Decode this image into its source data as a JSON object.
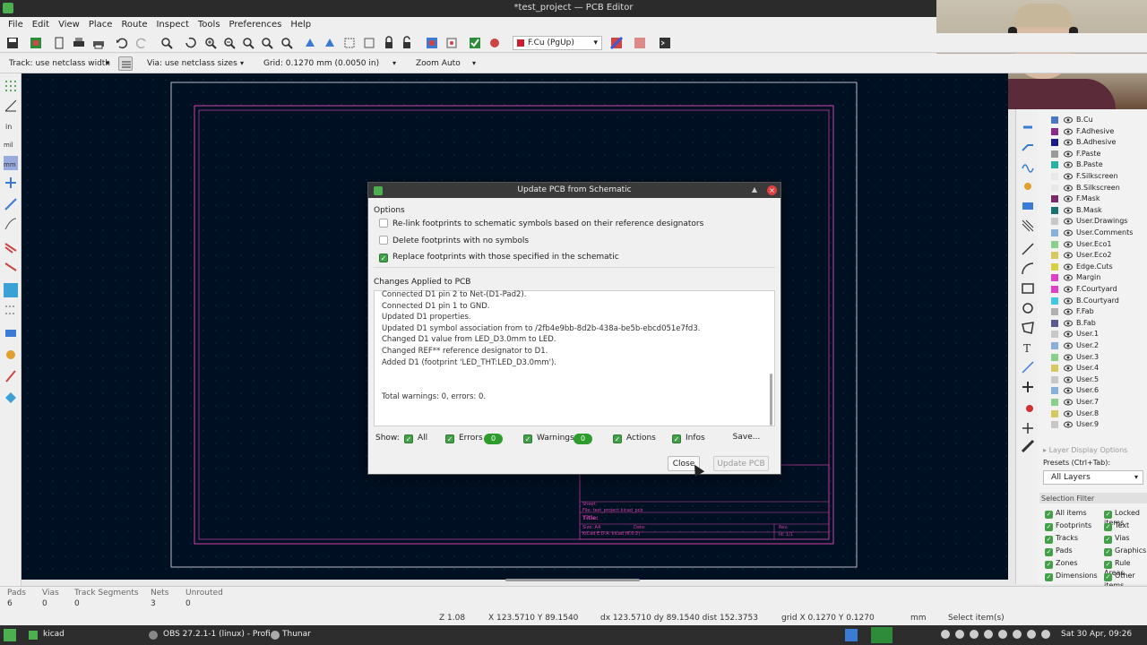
{
  "window": {
    "title": "*test_project — PCB Editor"
  },
  "menu": [
    "File",
    "Edit",
    "View",
    "Place",
    "Route",
    "Inspect",
    "Tools",
    "Preferences",
    "Help"
  ],
  "toolbar": {
    "layer": "F.Cu (PgUp)",
    "layer_color": "#c8202f"
  },
  "toolbar2": {
    "track": "Track: use netclass width",
    "via": "Via: use netclass sizes",
    "grid": "Grid: 0.1270 mm (0.0050 in)",
    "zoom": "Zoom Auto"
  },
  "layers": [
    {
      "name": "B.Cu",
      "color": "#4a78c8"
    },
    {
      "name": "F.Adhesive",
      "color": "#8a2a8a"
    },
    {
      "name": "B.Adhesive",
      "color": "#1a1a8a"
    },
    {
      "name": "F.Paste",
      "color": "#9a9a9a"
    },
    {
      "name": "B.Paste",
      "color": "#2ab0a0"
    },
    {
      "name": "F.Silkscreen",
      "color": "#e8e8e8"
    },
    {
      "name": "B.Silkscreen",
      "color": "#e8e8e8"
    },
    {
      "name": "F.Mask",
      "color": "#7a2a6a"
    },
    {
      "name": "B.Mask",
      "color": "#1a7070"
    },
    {
      "name": "User.Drawings",
      "color": "#c8c8c8"
    },
    {
      "name": "User.Comments",
      "color": "#8ab0d8"
    },
    {
      "name": "User.Eco1",
      "color": "#8ad088"
    },
    {
      "name": "User.Eco2",
      "color": "#d8c860"
    },
    {
      "name": "Edge.Cuts",
      "color": "#d8d040"
    },
    {
      "name": "Margin",
      "color": "#e040c8"
    },
    {
      "name": "F.Courtyard",
      "color": "#e040c8"
    },
    {
      "name": "B.Courtyard",
      "color": "#40c8e0"
    },
    {
      "name": "F.Fab",
      "color": "#b0b0b0"
    },
    {
      "name": "B.Fab",
      "color": "#5a5a90"
    },
    {
      "name": "User.1",
      "color": "#c8c8c8"
    },
    {
      "name": "User.2",
      "color": "#8ab0d8"
    },
    {
      "name": "User.3",
      "color": "#8ad088"
    },
    {
      "name": "User.4",
      "color": "#d8c860"
    },
    {
      "name": "User.5",
      "color": "#c8c8c8"
    },
    {
      "name": "User.6",
      "color": "#8ab0d8"
    },
    {
      "name": "User.7",
      "color": "#8ad088"
    },
    {
      "name": "User.8",
      "color": "#d8c860"
    },
    {
      "name": "User.9",
      "color": "#c8c8c8"
    }
  ],
  "layer_panel": {
    "display_options": "Layer Display Options",
    "presets_label": "Presets (Ctrl+Tab):",
    "presets_value": "All Layers",
    "selection_filter": "Selection Filter",
    "filters": [
      "All items",
      "Locked items",
      "Footprints",
      "Text",
      "Tracks",
      "Vias",
      "Pads",
      "Graphics",
      "Zones",
      "Rule Areas",
      "Dimensions",
      "Other items"
    ]
  },
  "dialog": {
    "title": "Update PCB from Schematic",
    "options_label": "Options",
    "opt_relink": "Re-link footprints to schematic symbols based on their reference designators",
    "opt_delete": "Delete footprints with no symbols",
    "opt_replace": "Replace footprints with those specified in the schematic",
    "changes_label": "Changes Applied to PCB",
    "changes": [
      "Connected D1 pin 2 to Net-(D1-Pad2).",
      "Connected D1 pin 1 to GND.",
      "Updated D1 properties.",
      "Updated D1 symbol association from  to /2fb4e9bb-8d2b-438a-be5b-ebcd051e7fd3.",
      "Changed D1 value from LED_D3.0mm to LED.",
      "Changed REF** reference designator to D1.",
      "Added D1 (footprint 'LED_THT:LED_D3.0mm')."
    ],
    "total": "Total warnings: 0, errors: 0.",
    "show_label": "Show:",
    "filter_all": "All",
    "filter_errors": "Errors",
    "errors_count": "0",
    "filter_warnings": "Warnings",
    "warnings_count": "0",
    "filter_actions": "Actions",
    "filter_infos": "Infos",
    "save_button": "Save...",
    "close_button": "Close",
    "update_button": "Update PCB"
  },
  "status": {
    "pads_label": "Pads",
    "pads": "6",
    "vias_label": "Vias",
    "vias": "0",
    "tracks_label": "Track Segments",
    "tracks": "0",
    "nets_label": "Nets",
    "nets": "3",
    "unrouted_label": "Unrouted",
    "unrouted": "0",
    "zoom": "Z 1.08",
    "xy": "X 123.5710  Y 89.1540",
    "dxdy": "dx 123.5710  dy 89.1540  dist 152.3753",
    "grid": "grid X 0.1270  Y 0.1270",
    "units": "mm",
    "selection": "Select item(s)"
  },
  "titleblock": {
    "sheet": "Sheet:",
    "file": "File: test_project.kicad_pcb",
    "title": "Title:",
    "size": "Size: A4",
    "date": "Date:",
    "kicad": "KiCad E.D.A.  kicad (6.0.2)",
    "rev": "Rev:",
    "id": "Id: 1/1"
  },
  "taskbar": {
    "kicad": "kicad",
    "obs": "OBS 27.2.1-1 (linux) - Profi...",
    "thunar": "Thunar",
    "clock": "Sat 30 Apr, 09:26"
  }
}
